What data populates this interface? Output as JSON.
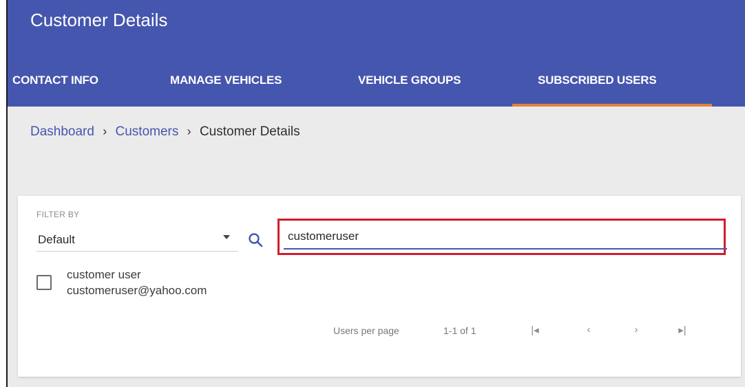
{
  "header": {
    "title": "Customer Details",
    "tabs": [
      {
        "label": "CONTACT INFO",
        "active": false
      },
      {
        "label": "MANAGE VEHICLES",
        "active": false
      },
      {
        "label": "VEHICLE GROUPS",
        "active": false
      },
      {
        "label": "SUBSCRIBED USERS",
        "active": true
      }
    ]
  },
  "breadcrumb": {
    "items": [
      "Dashboard",
      "Customers"
    ],
    "current": "Customer Details",
    "separator": "›"
  },
  "filter": {
    "label": "FILTER BY",
    "selected": "Default",
    "search_value": "customeruser"
  },
  "users": [
    {
      "name": "customer user",
      "email": "customeruser@yahoo.com",
      "checked": false
    }
  ],
  "pagination": {
    "per_page_label": "Users per page",
    "range": "1-1 of 1",
    "first_icon": "first-page-icon",
    "prev_icon": "chevron-left-icon",
    "next_icon": "chevron-right-icon",
    "last_icon": "last-page-icon"
  },
  "colors": {
    "header_bg": "#4556ae",
    "tab_indicator": "#e0833a",
    "link": "#4556ae",
    "highlight_border": "#d01c2a"
  }
}
